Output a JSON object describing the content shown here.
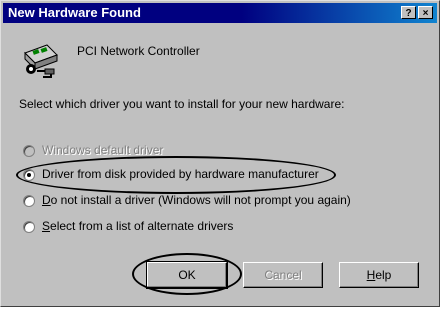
{
  "window": {
    "title": "New Hardware Found",
    "help_glyph": "?",
    "close_glyph": "×"
  },
  "device": {
    "icon": "network-card-icon",
    "name": "PCI Network Controller"
  },
  "prompt": "Select which driver you want to install for your new hardware:",
  "options": [
    {
      "label_pre": "Windows default driver",
      "label_ul": "",
      "label_post": "",
      "state": "disabled"
    },
    {
      "label_pre": "Driver from disk provided by hardware manufacturer",
      "label_ul": "",
      "label_post": "",
      "state": "selected"
    },
    {
      "label_pre": "",
      "label_ul": "D",
      "label_post": "o not install a driver (Windows will not prompt you again)",
      "state": "unselected"
    },
    {
      "label_pre": "",
      "label_ul": "S",
      "label_post": "elect from a list of alternate drivers",
      "state": "unselected"
    }
  ],
  "buttons": {
    "ok": "OK",
    "cancel": "Cancel",
    "help_ul": "H",
    "help_rest": "elp"
  }
}
